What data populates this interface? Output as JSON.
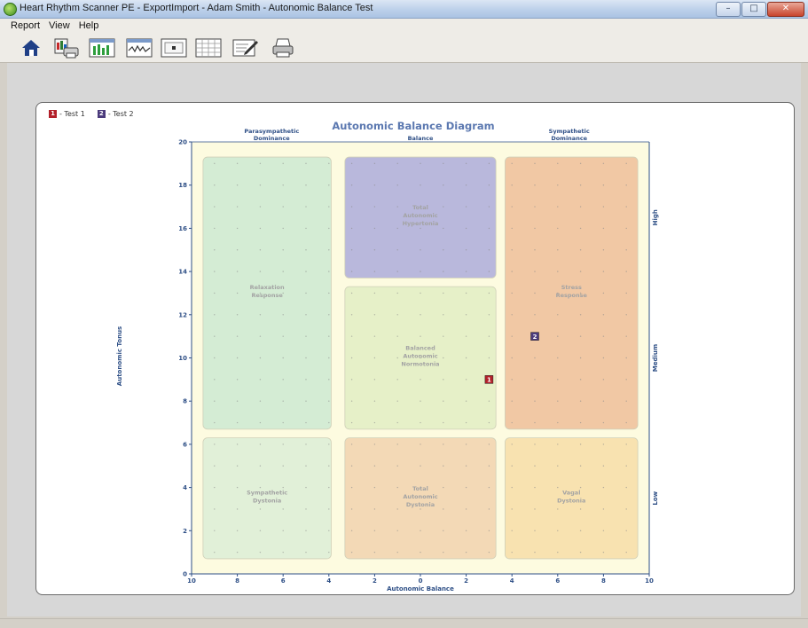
{
  "window": {
    "title": "Heart Rhythm Scanner PE - ExportImport - Adam Smith - Autonomic Balance Test",
    "buttons": {
      "minimize": "–",
      "maximize": "□",
      "close": "✕"
    }
  },
  "menu": {
    "items": [
      "Report",
      "View",
      "Help"
    ]
  },
  "toolbar": {
    "buttons": [
      {
        "name": "home",
        "icon": "home-icon"
      },
      {
        "name": "print-report",
        "icon": "print-report-icon"
      },
      {
        "name": "bar-chart",
        "icon": "bar-chart-icon"
      },
      {
        "name": "rhythm",
        "icon": "rhythm-graph-icon"
      },
      {
        "name": "scatter",
        "icon": "scatter-icon"
      },
      {
        "name": "grid",
        "icon": "grid-icon"
      },
      {
        "name": "notes",
        "icon": "edit-notes-icon"
      },
      {
        "name": "printer",
        "icon": "printer-icon"
      }
    ]
  },
  "legend": [
    {
      "label": "- Test 1",
      "marker": "1",
      "color": "#b3202a"
    },
    {
      "label": "- Test 2",
      "marker": "2",
      "color": "#4b3a7c"
    }
  ],
  "chart_data": {
    "type": "scatter",
    "title": "Autonomic Balance Diagram",
    "xlabel": "Autonomic Balance",
    "ylabel": "Autonomic Tonus",
    "xlim": [
      -10,
      10
    ],
    "ylim": [
      0,
      20
    ],
    "x_ticks": [
      {
        "v": -10,
        "label": "10"
      },
      {
        "v": -8,
        "label": "8"
      },
      {
        "v": -6,
        "label": "6"
      },
      {
        "v": -4,
        "label": "4"
      },
      {
        "v": -2,
        "label": "2"
      },
      {
        "v": 0,
        "label": "0"
      },
      {
        "v": 2,
        "label": "2"
      },
      {
        "v": 4,
        "label": "4"
      },
      {
        "v": 6,
        "label": "6"
      },
      {
        "v": 8,
        "label": "8"
      },
      {
        "v": 10,
        "label": "10"
      }
    ],
    "y_ticks": [
      {
        "v": 0,
        "label": "0"
      },
      {
        "v": 2,
        "label": "2"
      },
      {
        "v": 4,
        "label": "4"
      },
      {
        "v": 6,
        "label": "6"
      },
      {
        "v": 8,
        "label": "8"
      },
      {
        "v": 10,
        "label": "10"
      },
      {
        "v": 12,
        "label": "12"
      },
      {
        "v": 14,
        "label": "14"
      },
      {
        "v": 16,
        "label": "16"
      },
      {
        "v": 18,
        "label": "18"
      },
      {
        "v": 20,
        "label": "20"
      }
    ],
    "top_labels": [
      {
        "x": -6.5,
        "lines": [
          "Parasympathetic",
          "Dominance"
        ]
      },
      {
        "x": 0,
        "lines": [
          "Balance"
        ]
      },
      {
        "x": 6.5,
        "lines": [
          "Sympathetic",
          "Dominance"
        ]
      }
    ],
    "right_labels": [
      {
        "y": 16.5,
        "text": "High"
      },
      {
        "y": 10,
        "text": "Medium"
      },
      {
        "y": 3.5,
        "text": "Low"
      }
    ],
    "regions": [
      {
        "name": "Relaxation Response",
        "lines": [
          "Relaxation",
          "Response"
        ],
        "x0": -9.5,
        "x1": -3.9,
        "y0": 6.7,
        "y1": 19.3,
        "color": "#d4ecd4"
      },
      {
        "name": "Total Autonomic Hypertonia",
        "lines": [
          "Total",
          "Autonomic",
          "Hypertonia"
        ],
        "x0": -3.3,
        "x1": 3.3,
        "y0": 13.7,
        "y1": 19.3,
        "color": "#b9b8dc"
      },
      {
        "name": "Balanced Autonomic Normotonia",
        "lines": [
          "Balanced",
          "Autonomic",
          "Normotonia"
        ],
        "x0": -3.3,
        "x1": 3.3,
        "y0": 6.7,
        "y1": 13.3,
        "color": "#e6f0c8"
      },
      {
        "name": "Stress Response",
        "lines": [
          "Stress",
          "Response"
        ],
        "x0": 3.7,
        "x1": 9.5,
        "y0": 6.7,
        "y1": 19.3,
        "color": "#f1c8a4"
      },
      {
        "name": "Sympathetic Dystonia",
        "lines": [
          "Sympathetic",
          "Dystonia"
        ],
        "x0": -9.5,
        "x1": -3.9,
        "y0": 0.7,
        "y1": 6.3,
        "color": "#e1f0d8"
      },
      {
        "name": "Total Autonomic Dystonia",
        "lines": [
          "Total",
          "Autonomic",
          "Dystonia"
        ],
        "x0": -3.3,
        "x1": 3.3,
        "y0": 0.7,
        "y1": 6.3,
        "color": "#f3d9b6"
      },
      {
        "name": "Vagal Dystonia",
        "lines": [
          "Vagal",
          "Dystonia"
        ],
        "x0": 3.7,
        "x1": 9.5,
        "y0": 0.7,
        "y1": 6.3,
        "color": "#f8e2b0"
      }
    ],
    "points": [
      {
        "series": "Test 1",
        "marker": "1",
        "x": 3,
        "y": 9,
        "color": "#b3202a"
      },
      {
        "series": "Test 2",
        "marker": "2",
        "x": 5,
        "y": 11,
        "color": "#4b3a7c"
      }
    ],
    "plot_background": "#fdfbe0",
    "axis_color": "#2e4f86"
  }
}
